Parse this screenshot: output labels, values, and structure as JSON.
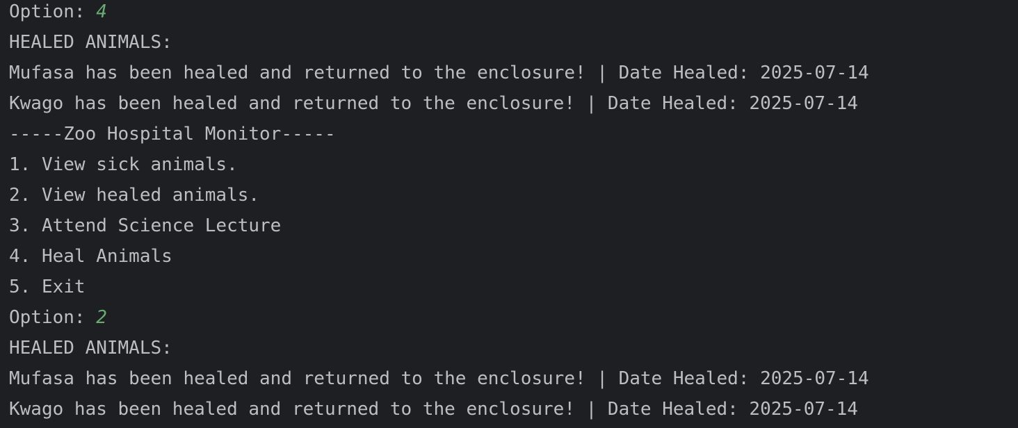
{
  "console": {
    "colors": {
      "background": "#1e1f22",
      "text": "#bcbec4",
      "user_input": "#6aab73"
    },
    "lines": [
      {
        "prefix": "Option: ",
        "input": "4"
      },
      {
        "text": "HEALED ANIMALS:"
      },
      {
        "text": "Mufasa has been healed and returned to the enclosure! | Date Healed: 2025-07-14"
      },
      {
        "text": "Kwago has been healed and returned to the enclosure! | Date Healed: 2025-07-14"
      },
      {
        "text": "-----Zoo Hospital Monitor-----"
      },
      {
        "text": "1. View sick animals."
      },
      {
        "text": "2. View healed animals."
      },
      {
        "text": "3. Attend Science Lecture"
      },
      {
        "text": "4. Heal Animals"
      },
      {
        "text": "5. Exit"
      },
      {
        "prefix": "Option: ",
        "input": "2"
      },
      {
        "text": "HEALED ANIMALS:"
      },
      {
        "text": "Mufasa has been healed and returned to the enclosure! | Date Healed: 2025-07-14"
      },
      {
        "text": "Kwago has been healed and returned to the enclosure! | Date Healed: 2025-07-14"
      }
    ]
  }
}
